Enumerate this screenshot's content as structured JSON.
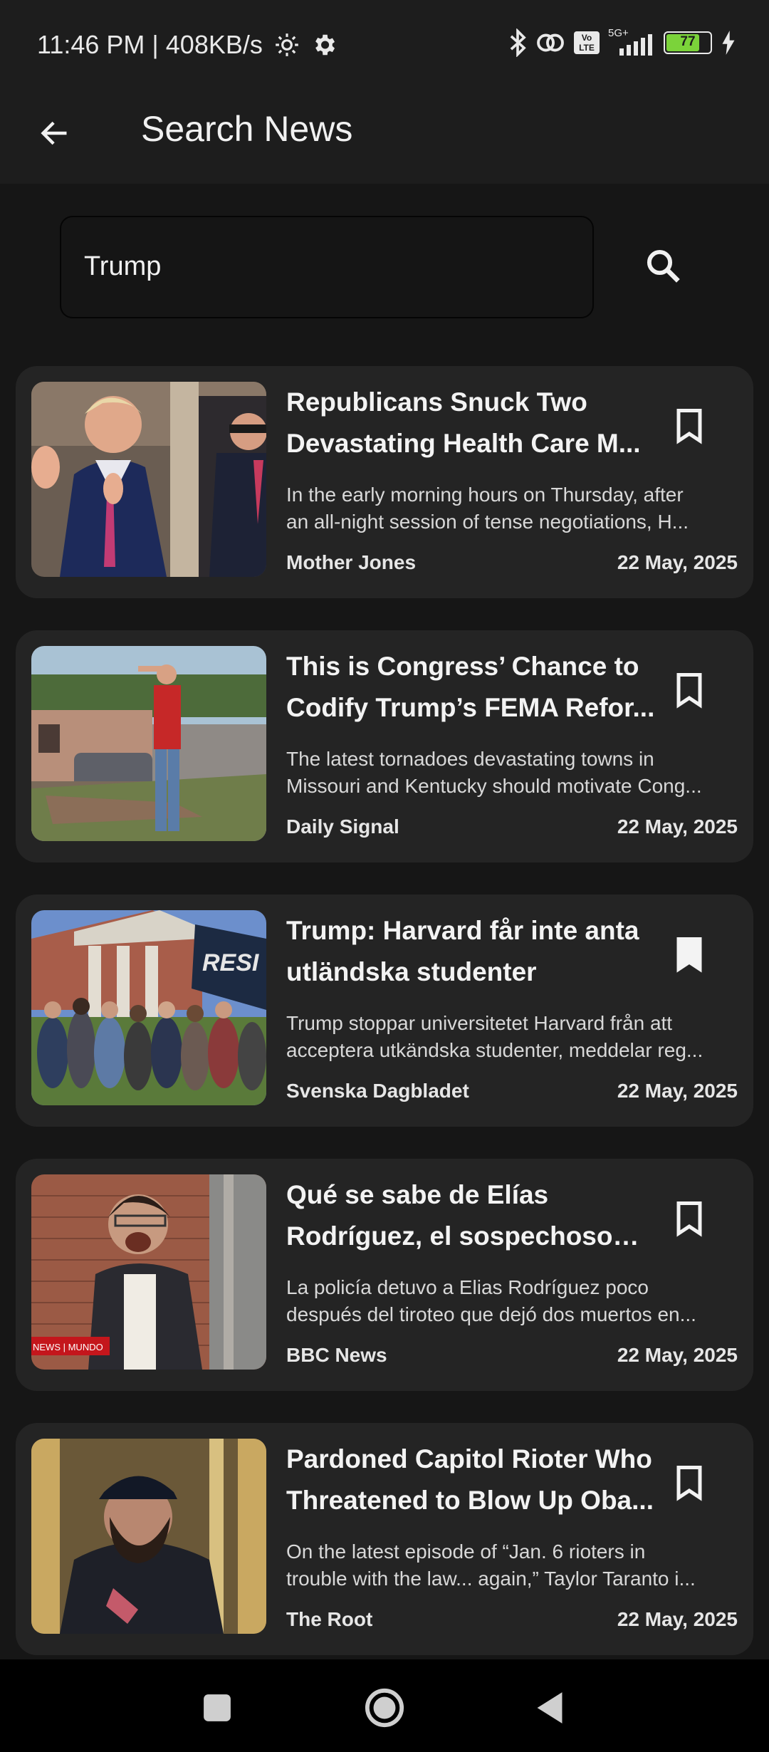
{
  "status": {
    "time_speed": "11:46 PM | 408KB/s",
    "battery": "77",
    "network": "5G+",
    "volte": "Vo LTE"
  },
  "app_bar": {
    "title": "Search News"
  },
  "search": {
    "query": "Trump"
  },
  "articles": [
    {
      "title": "Republicans Snuck Two Devastating Health Care M...",
      "desc_line1": "In the early morning hours on Thursday, after",
      "desc_line2": "an all-night session of tense negotiations, H...",
      "source": "Mother Jones",
      "date": "22 May, 2025",
      "bookmarked": false,
      "image": "trump-speaking-photo"
    },
    {
      "title": "This is Congress’ Chance to Codify Trump’s FEMA Refor...",
      "desc_line1": "The latest tornadoes devastating towns in",
      "desc_line2": "Missouri and Kentucky should motivate Cong...",
      "source": "Daily Signal",
      "date": "22 May, 2025",
      "bookmarked": false,
      "image": "tornado-damage-photo"
    },
    {
      "title": "Trump: Harvard får inte anta utländska studenter",
      "desc_line1": "Trump stoppar universitetet Harvard från att",
      "desc_line2": "acceptera utkändska studenter, meddelar reg...",
      "source": "Svenska Dagbladet",
      "date": "22 May, 2025",
      "bookmarked": true,
      "image": "harvard-crowd-photo",
      "image_sign_text": "RESI"
    },
    {
      "title": "Qué se sabe de Elías Rodríguez, el sospechoso d...",
      "desc_line1": "La policía detuvo a Elias Rodríguez poco",
      "desc_line2": "después del tiroteo que dejó dos muertos en...",
      "source": "BBC News",
      "date": "22 May, 2025",
      "bookmarked": false,
      "image": "suspect-photo",
      "image_tag": "NEWS | MUNDO"
    },
    {
      "title": "Pardoned Capitol Rioter Who Threatened to Blow Up Oba...",
      "desc_line1": "On the latest episode of “Jan. 6 rioters in",
      "desc_line2": "trouble with the law... again,” Taylor Taranto i...",
      "source": "The Root",
      "date": "22 May, 2025",
      "bookmarked": false,
      "image": "capitol-rioter-photo"
    }
  ],
  "colors": {
    "background": "#161616",
    "bar": "#1d1d1d",
    "card": "#242424",
    "battery": "#7bd33a"
  }
}
